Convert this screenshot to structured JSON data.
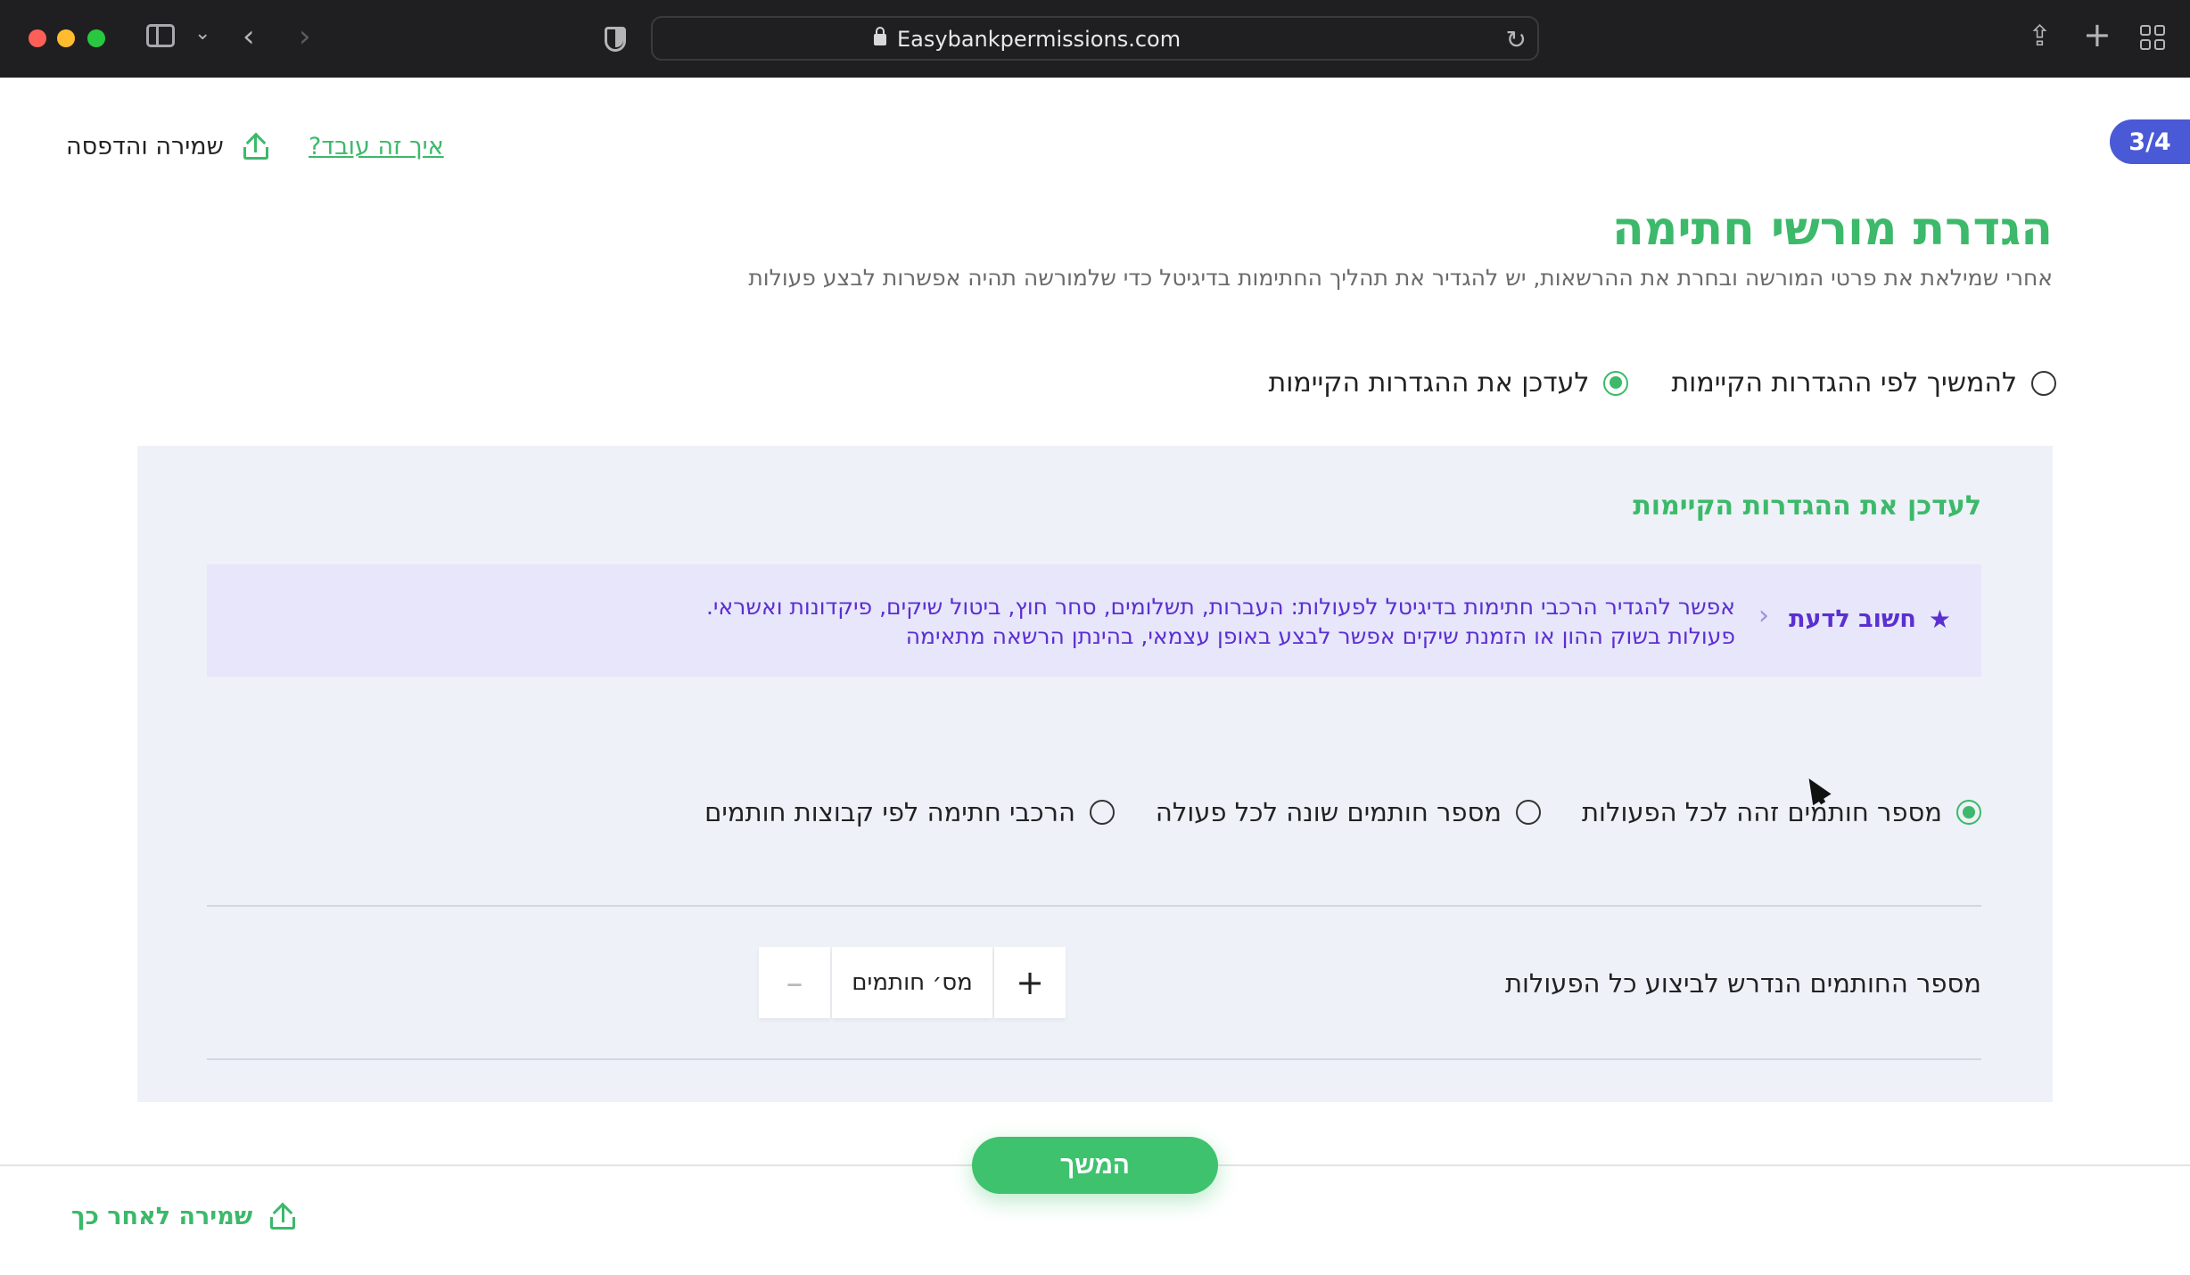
{
  "browser": {
    "url": "Easybankpermissions.com"
  },
  "header": {
    "step": "3/4",
    "save_print_label": "שמירה והדפסה",
    "how_it_works_link": "איך זה עובד?"
  },
  "main": {
    "title": "הגדרת מורשי חתימה",
    "subtitle": "אחרי שמילאת את פרטי המורשה ובחרת את ההרשאות, יש להגדיר את תהליך החתימות בדיגיטל כדי שלמורשה תהיה אפשרות לבצע פעולות",
    "options": [
      {
        "label": "להמשיך לפי ההגדרות הקיימות",
        "checked": false
      },
      {
        "label": "לעדכן את ההגדרות הקיימות",
        "checked": true
      }
    ]
  },
  "panel": {
    "title": "לעדכן את ההגדרות הקיימות",
    "notice": {
      "label": "חשוב לדעת",
      "line1": "אפשר להגדיר הרכבי חתימות בדיגיטל לפעולות: העברות, תשלומים, סחר חוץ, ביטול שיקים, פיקדונות ואשראי.",
      "line2": "פעולות בשוק ההון או הזמנת שיקים אפשר לבצע באופן עצמאי, בהינתן הרשאה מתאימה"
    },
    "modes": [
      {
        "label": "מספר חותמים זהה לכל הפעולות",
        "checked": true
      },
      {
        "label": "מספר חותמים שונה לכל פעולה",
        "checked": false
      },
      {
        "label": "הרכבי חתימה לפי קבוצות חותמים",
        "checked": false
      }
    ],
    "signers": {
      "label": "מספר החותמים הנדרש לביצוע כל הפעולות",
      "field_placeholder": "מס׳ חותמים",
      "plus": "+",
      "minus": "–"
    }
  },
  "footer": {
    "continue_label": "המשך",
    "save_later_label": "שמירה לאחר כך"
  },
  "colors": {
    "brand_green": "#3cb96a",
    "notice_purple": "#5b2fd1",
    "step_blue": "#4a5ad6"
  }
}
